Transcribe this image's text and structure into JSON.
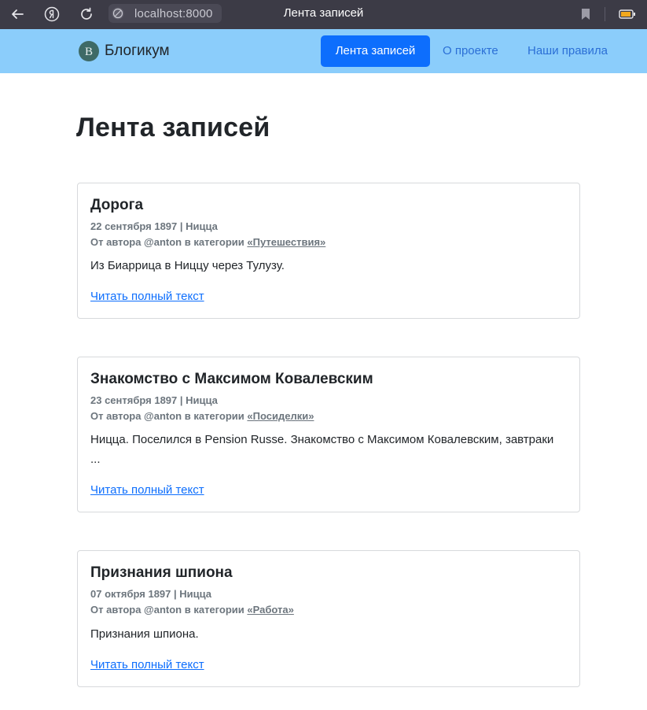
{
  "browser": {
    "url": "localhost:8000",
    "tab_title": "Лента записей"
  },
  "navbar": {
    "brand_letter": "В",
    "brand_name": "Блогикум",
    "links": [
      {
        "label": "Лента записей",
        "active": true
      },
      {
        "label": "О проекте",
        "active": false
      },
      {
        "label": "Наши правила",
        "active": false
      }
    ]
  },
  "page": {
    "title": "Лента записей"
  },
  "posts": [
    {
      "title": "Дорога",
      "date_location": "22 сентября 1897 | Ницца",
      "author_prefix": "От автора @anton в категории",
      "category": "«Путешествия»",
      "text": "Из Биаррица в Ниццу через Тулузу.",
      "read_more": "Читать полный текст"
    },
    {
      "title": "Знакомство с Максимом Ковалевским",
      "date_location": "23 сентября 1897 | Ницца",
      "author_prefix": "От автора @anton в категории",
      "category": "«Посиделки»",
      "text": "Ницца. Поселился в Pension Russe. Знакомство с Максимом Ковалевским, завтраки ...",
      "read_more": "Читать полный текст"
    },
    {
      "title": "Признания шпиона",
      "date_location": "07 октября 1897 | Ницца",
      "author_prefix": "От автора @anton в категории",
      "category": "«Работа»",
      "text": "Признания шпиона.",
      "read_more": "Читать полный текст"
    }
  ],
  "colors": {
    "browser_bar": "#3c3b46",
    "navbar": "#8bcdfb",
    "accent": "#0d6efd",
    "muted": "#6c757d"
  },
  "icons": [
    "back-arrow-icon",
    "yandex-icon",
    "reload-icon",
    "site-globe-icon",
    "bookmark-icon",
    "battery-icon"
  ]
}
